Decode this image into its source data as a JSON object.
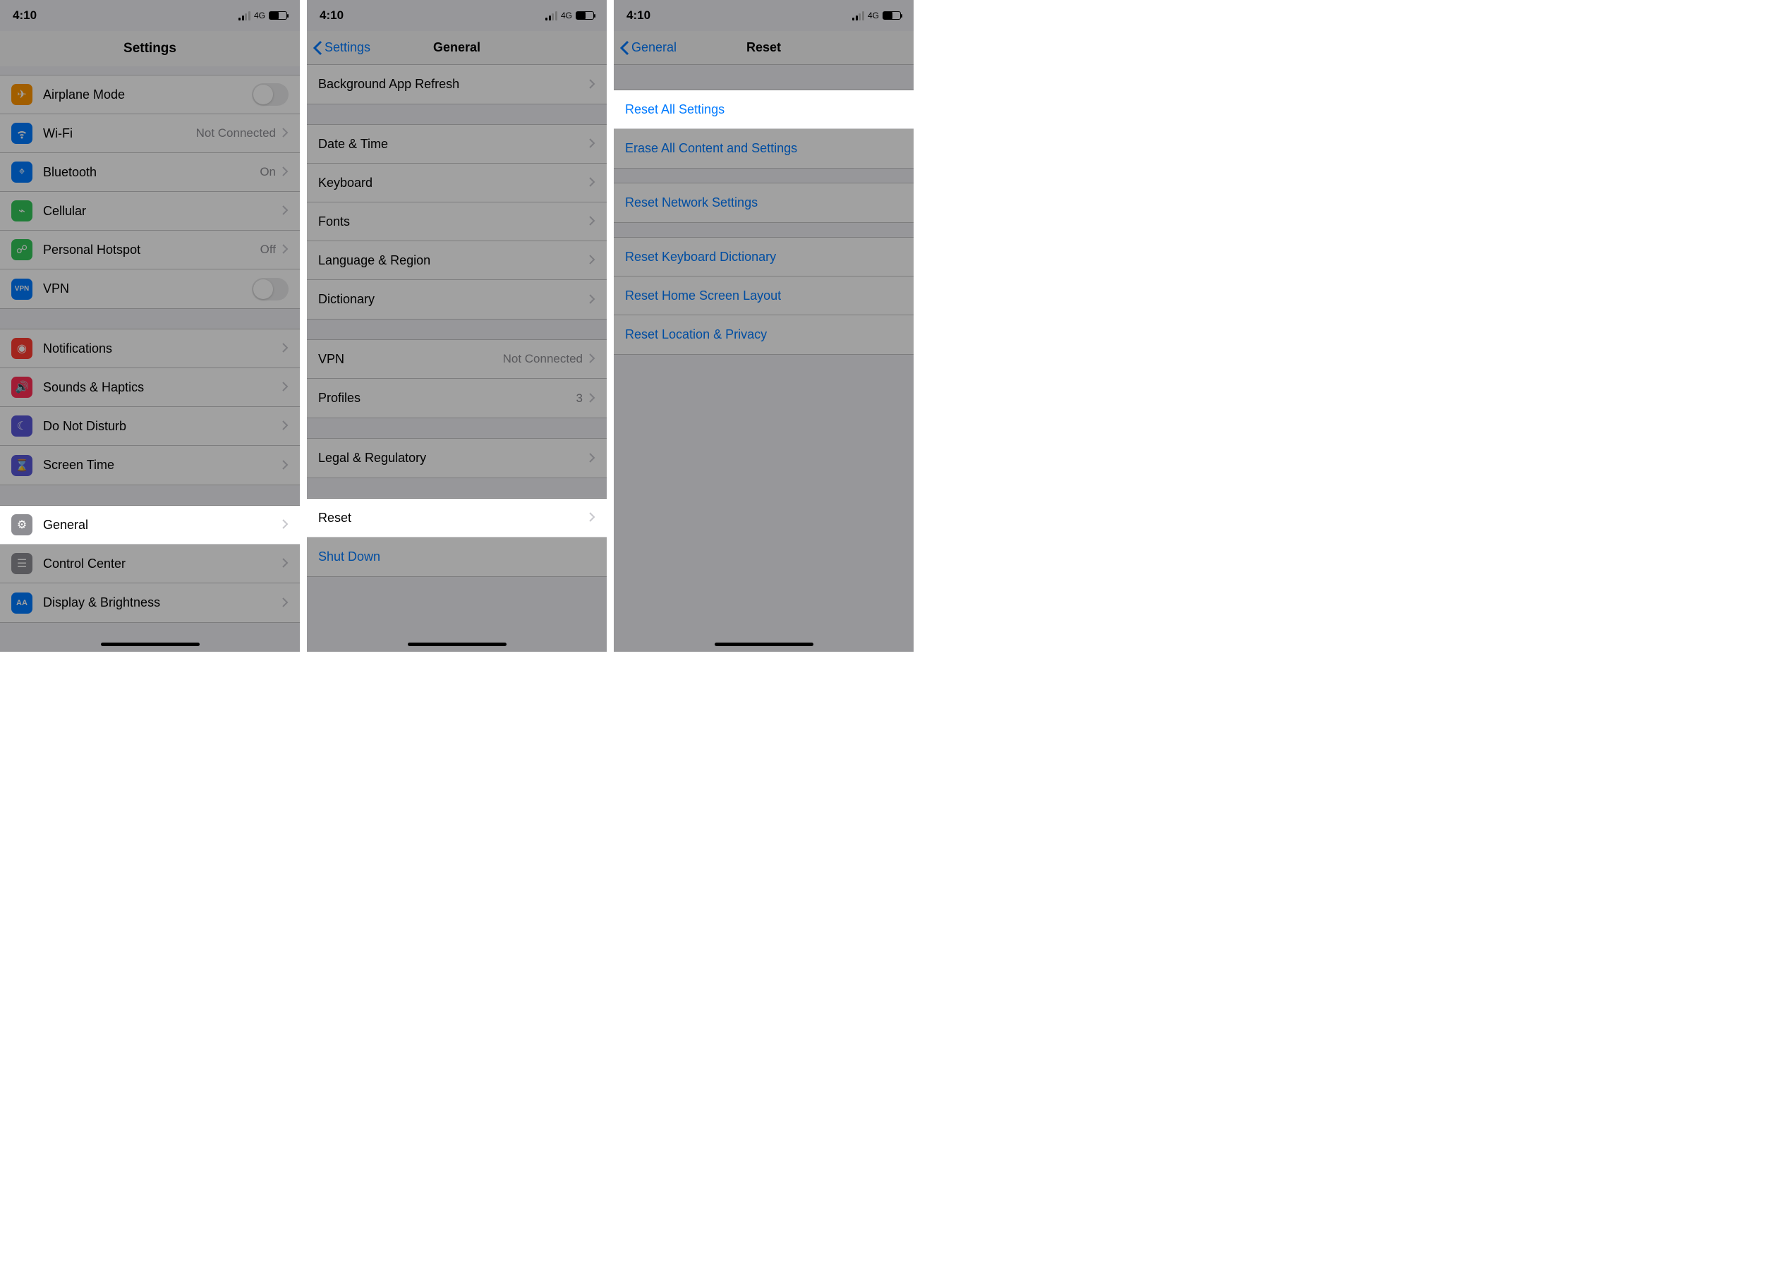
{
  "status": {
    "time": "4:10",
    "network": "4G"
  },
  "panel1": {
    "title": "Settings",
    "rows": {
      "airplane": "Airplane Mode",
      "wifi": "Wi-Fi",
      "wifi_detail": "Not Connected",
      "bluetooth": "Bluetooth",
      "bluetooth_detail": "On",
      "cellular": "Cellular",
      "hotspot": "Personal Hotspot",
      "hotspot_detail": "Off",
      "vpn": "VPN",
      "notifications": "Notifications",
      "sounds": "Sounds & Haptics",
      "dnd": "Do Not Disturb",
      "screentime": "Screen Time",
      "general": "General",
      "controlcenter": "Control Center",
      "display": "Display & Brightness"
    }
  },
  "panel2": {
    "back": "Settings",
    "title": "General",
    "rows": {
      "bgrefresh": "Background App Refresh",
      "datetime": "Date & Time",
      "keyboard": "Keyboard",
      "fonts": "Fonts",
      "language": "Language & Region",
      "dictionary": "Dictionary",
      "vpn": "VPN",
      "vpn_detail": "Not Connected",
      "profiles": "Profiles",
      "profiles_detail": "3",
      "legal": "Legal & Regulatory",
      "reset": "Reset",
      "shutdown": "Shut Down"
    }
  },
  "panel3": {
    "back": "General",
    "title": "Reset",
    "rows": {
      "resetall": "Reset All Settings",
      "erase": "Erase All Content and Settings",
      "network": "Reset Network Settings",
      "keyboard": "Reset Keyboard Dictionary",
      "home": "Reset Home Screen Layout",
      "location": "Reset Location & Privacy"
    }
  }
}
